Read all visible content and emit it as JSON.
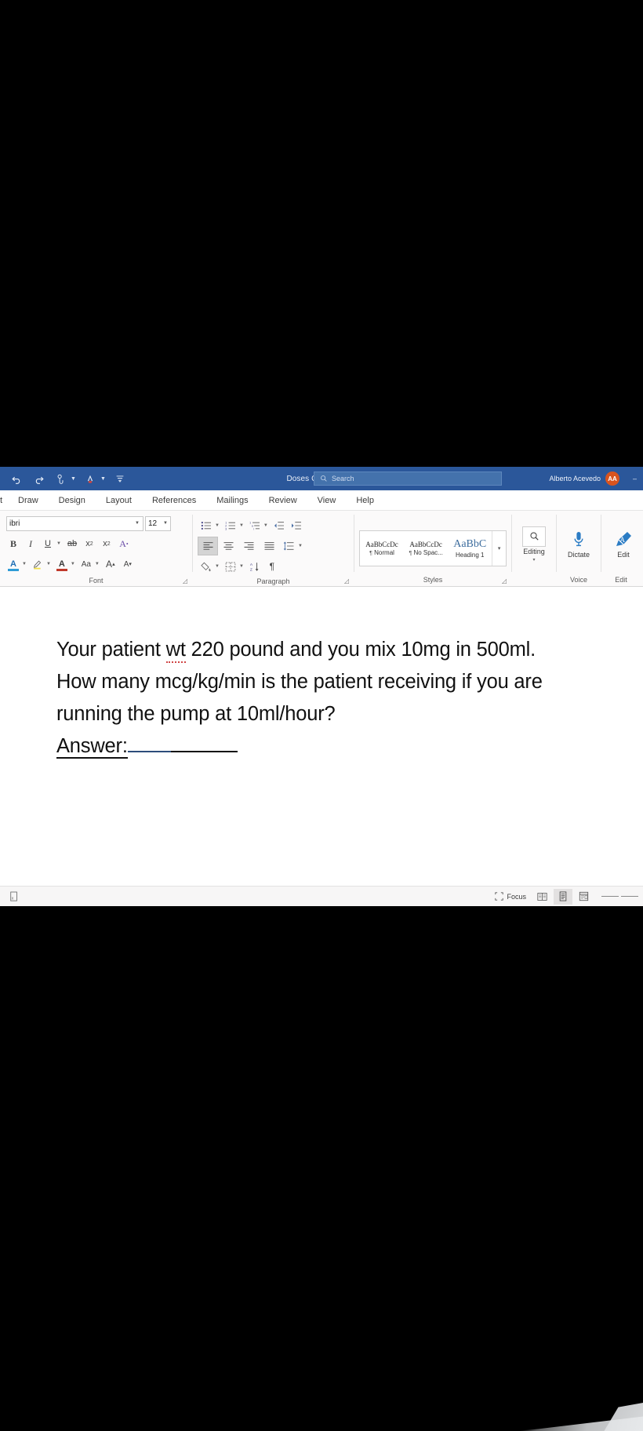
{
  "app": {
    "name": "Microsoft Word",
    "document_title": "Doses Calculati...",
    "accent_color": "#2b579a",
    "avatar_color": "#d9541e"
  },
  "titlebar": {
    "quick_access": [
      {
        "name": "undo",
        "label": "Undo",
        "has_caret": false
      },
      {
        "name": "redo",
        "label": "Redo",
        "has_caret": false
      },
      {
        "name": "touch-mouse-mode",
        "label": "Touch/Mouse Mode",
        "has_caret": true
      },
      {
        "name": "read-aloud",
        "label": "Read Aloud",
        "has_caret": true
      },
      {
        "name": "customize-quick-access-toolbar",
        "label": "Customize Quick Access Toolbar",
        "has_caret": false
      }
    ],
    "title_caret": "▾",
    "search": {
      "placeholder": "Search",
      "value": ""
    },
    "account": {
      "name": "Alberto Acevedo",
      "initials": "AA"
    },
    "window_controls": [
      "–",
      "❐",
      "✕"
    ]
  },
  "ribbon": {
    "tabs": [
      {
        "label": "t",
        "clipped": true
      },
      {
        "label": "Draw"
      },
      {
        "label": "Design"
      },
      {
        "label": "Layout"
      },
      {
        "label": "References"
      },
      {
        "label": "Mailings"
      },
      {
        "label": "Review"
      },
      {
        "label": "View"
      },
      {
        "label": "Help"
      }
    ],
    "groups": {
      "font": {
        "label": "Font",
        "font_name": "ibri",
        "font_size": "12",
        "row1": [
          {
            "name": "bold-button",
            "glyph": "B"
          },
          {
            "name": "italic-button",
            "glyph": "I"
          },
          {
            "name": "underline-button",
            "glyph": "U",
            "caret": true
          },
          {
            "name": "strikethrough-button",
            "glyph": "ab"
          },
          {
            "name": "subscript-button",
            "glyph": "x"
          },
          {
            "name": "superscript-button",
            "glyph": "x"
          },
          {
            "name": "text-effects-button",
            "glyph": "A"
          }
        ],
        "row2": [
          {
            "name": "text-highlight-color-button",
            "glyph": "A",
            "caret": true
          },
          {
            "name": "highlighter-pen-button",
            "glyph": "✎",
            "caret": true
          },
          {
            "name": "font-color-button",
            "glyph": "A",
            "caret": true
          },
          {
            "name": "change-case-button",
            "glyph": "Aa",
            "caret": true
          },
          {
            "name": "grow-font-button",
            "glyph": "A"
          },
          {
            "name": "shrink-font-button",
            "glyph": "A"
          }
        ]
      },
      "paragraph": {
        "label": "Paragraph",
        "row1": [
          {
            "name": "bullets-button",
            "caret": true
          },
          {
            "name": "numbering-button",
            "caret": true
          },
          {
            "name": "multilevel-list-button",
            "caret": true
          },
          {
            "name": "decrease-indent-button",
            "caret": false
          },
          {
            "name": "increase-indent-button",
            "caret": false
          }
        ],
        "row2": [
          {
            "name": "align-left-button",
            "selected": true
          },
          {
            "name": "align-center-button",
            "selected": false
          },
          {
            "name": "align-right-button",
            "selected": false
          },
          {
            "name": "justify-button",
            "selected": false
          },
          {
            "name": "line-spacing-button",
            "caret": true
          }
        ],
        "row3": [
          {
            "name": "shading-button",
            "caret": true
          },
          {
            "name": "borders-button",
            "caret": true
          },
          {
            "name": "sort-button",
            "caret": false
          },
          {
            "name": "show-formatting-marks-button",
            "glyph": "¶"
          }
        ]
      },
      "styles": {
        "label": "Styles",
        "items": [
          {
            "preview": "AaBbCcDc",
            "name": "Normal",
            "pilcrow": "¶"
          },
          {
            "preview": "AaBbCcDc",
            "name": "No Spac...",
            "pilcrow": "¶"
          },
          {
            "preview": "AaBbC",
            "name": "Heading 1",
            "pilcrow": ""
          }
        ],
        "more_caret": "▾"
      },
      "editing": {
        "label": "Editing",
        "caret": "▾"
      },
      "voice": {
        "label": "Voice",
        "button": "Dictate"
      },
      "editor": {
        "label": "Edit",
        "button": "Edit"
      }
    }
  },
  "document": {
    "line1_a": "Your patient ",
    "line1_misspelled": "wt",
    "line1_b": " 220 pound and you mix 10mg in 500ml. How many mcg/kg/min is the patient receiving if you are running the pump at 10ml/hour?",
    "answer_label": "Answer:",
    "answer_blank": ""
  },
  "statusbar": {
    "accessibility_label": "",
    "focus_label": "Focus",
    "views": [
      {
        "name": "read-mode-button",
        "active": false
      },
      {
        "name": "print-layout-button",
        "active": true
      },
      {
        "name": "web-layout-button",
        "active": false
      }
    ]
  }
}
